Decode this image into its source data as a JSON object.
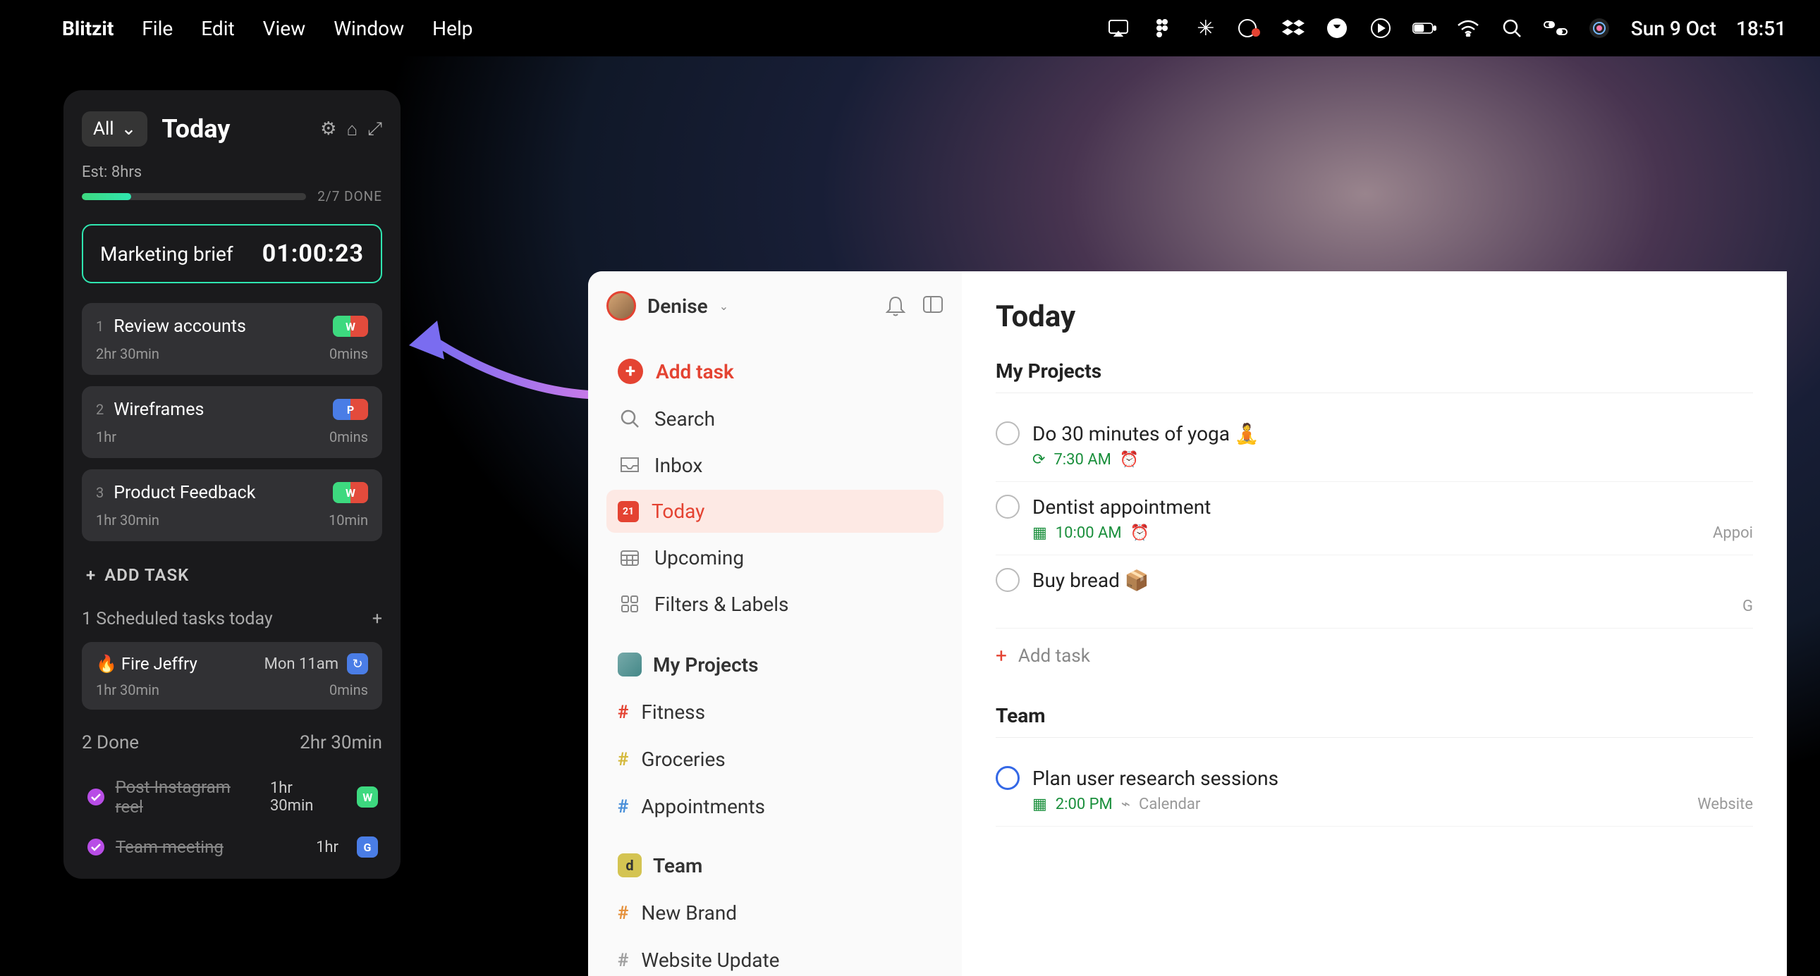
{
  "menubar": {
    "app": "Blitzit",
    "items": [
      "File",
      "Edit",
      "View",
      "Window",
      "Help"
    ],
    "date": "Sun 9 Oct",
    "time": "18:51"
  },
  "blitzit": {
    "filter": "All",
    "title": "Today",
    "estimate": "Est: 8hrs",
    "progressLabel": "2/7 DONE",
    "timer": {
      "name": "Marketing brief",
      "time": "01:00:23"
    },
    "tasks": [
      {
        "num": "1",
        "name": "Review accounts",
        "est": "2hr 30min",
        "spent": "0mins",
        "tag": "W"
      },
      {
        "num": "2",
        "name": "Wireframes",
        "est": "1hr",
        "spent": "0mins",
        "tag": "P"
      },
      {
        "num": "3",
        "name": "Product Feedback",
        "est": "1hr 30min",
        "spent": "10min",
        "tag": "W"
      }
    ],
    "addTask": "ADD TASK",
    "scheduledTitle": "1 Scheduled tasks today",
    "scheduled": {
      "name": "🔥 Fire Jeffry",
      "time": "Mon 11am",
      "est": "1hr 30min",
      "spent": "0mins"
    },
    "doneTitle": "2 Done",
    "doneDuration": "2hr 30min",
    "done": [
      {
        "name": "Post Instagram reel",
        "dur": "1hr 30min",
        "badge": "W"
      },
      {
        "name": "Team meeting",
        "dur": "1hr",
        "badge": "G"
      }
    ]
  },
  "todoist": {
    "user": "Denise",
    "nav": {
      "add": "Add task",
      "search": "Search",
      "inbox": "Inbox",
      "today": "Today",
      "todayNum": "21",
      "upcoming": "Upcoming",
      "filters": "Filters & Labels"
    },
    "projectsTitle": "My Projects",
    "projects": [
      {
        "name": "Fitness",
        "color": "#e44332"
      },
      {
        "name": "Groceries",
        "color": "#d4b93c"
      },
      {
        "name": "Appointments",
        "color": "#4a90d9"
      }
    ],
    "teamTitle": "Team",
    "teams": [
      {
        "name": "New Brand",
        "color": "#e5913c"
      },
      {
        "name": "Website Update",
        "color": "#a0a0a0"
      }
    ],
    "main": {
      "title": "Today",
      "section1": "My Projects",
      "tasks1": [
        {
          "name": "Do 30 minutes of yoga 🧘",
          "time": "7:30 AM",
          "icon": "⟳",
          "alarm": true,
          "right": ""
        },
        {
          "name": "Dentist appointment",
          "time": "10:00 AM",
          "icon": "📅",
          "alarm": true,
          "right": "Appoi"
        },
        {
          "name": "Buy bread 📦",
          "time": "",
          "icon": "",
          "alarm": false,
          "right": "G"
        }
      ],
      "addTask": "Add task",
      "section2": "Team",
      "tasks2": [
        {
          "name": "Plan user research sessions",
          "time": "2:00 PM",
          "cal": "Calendar",
          "right": "Website"
        }
      ]
    }
  }
}
